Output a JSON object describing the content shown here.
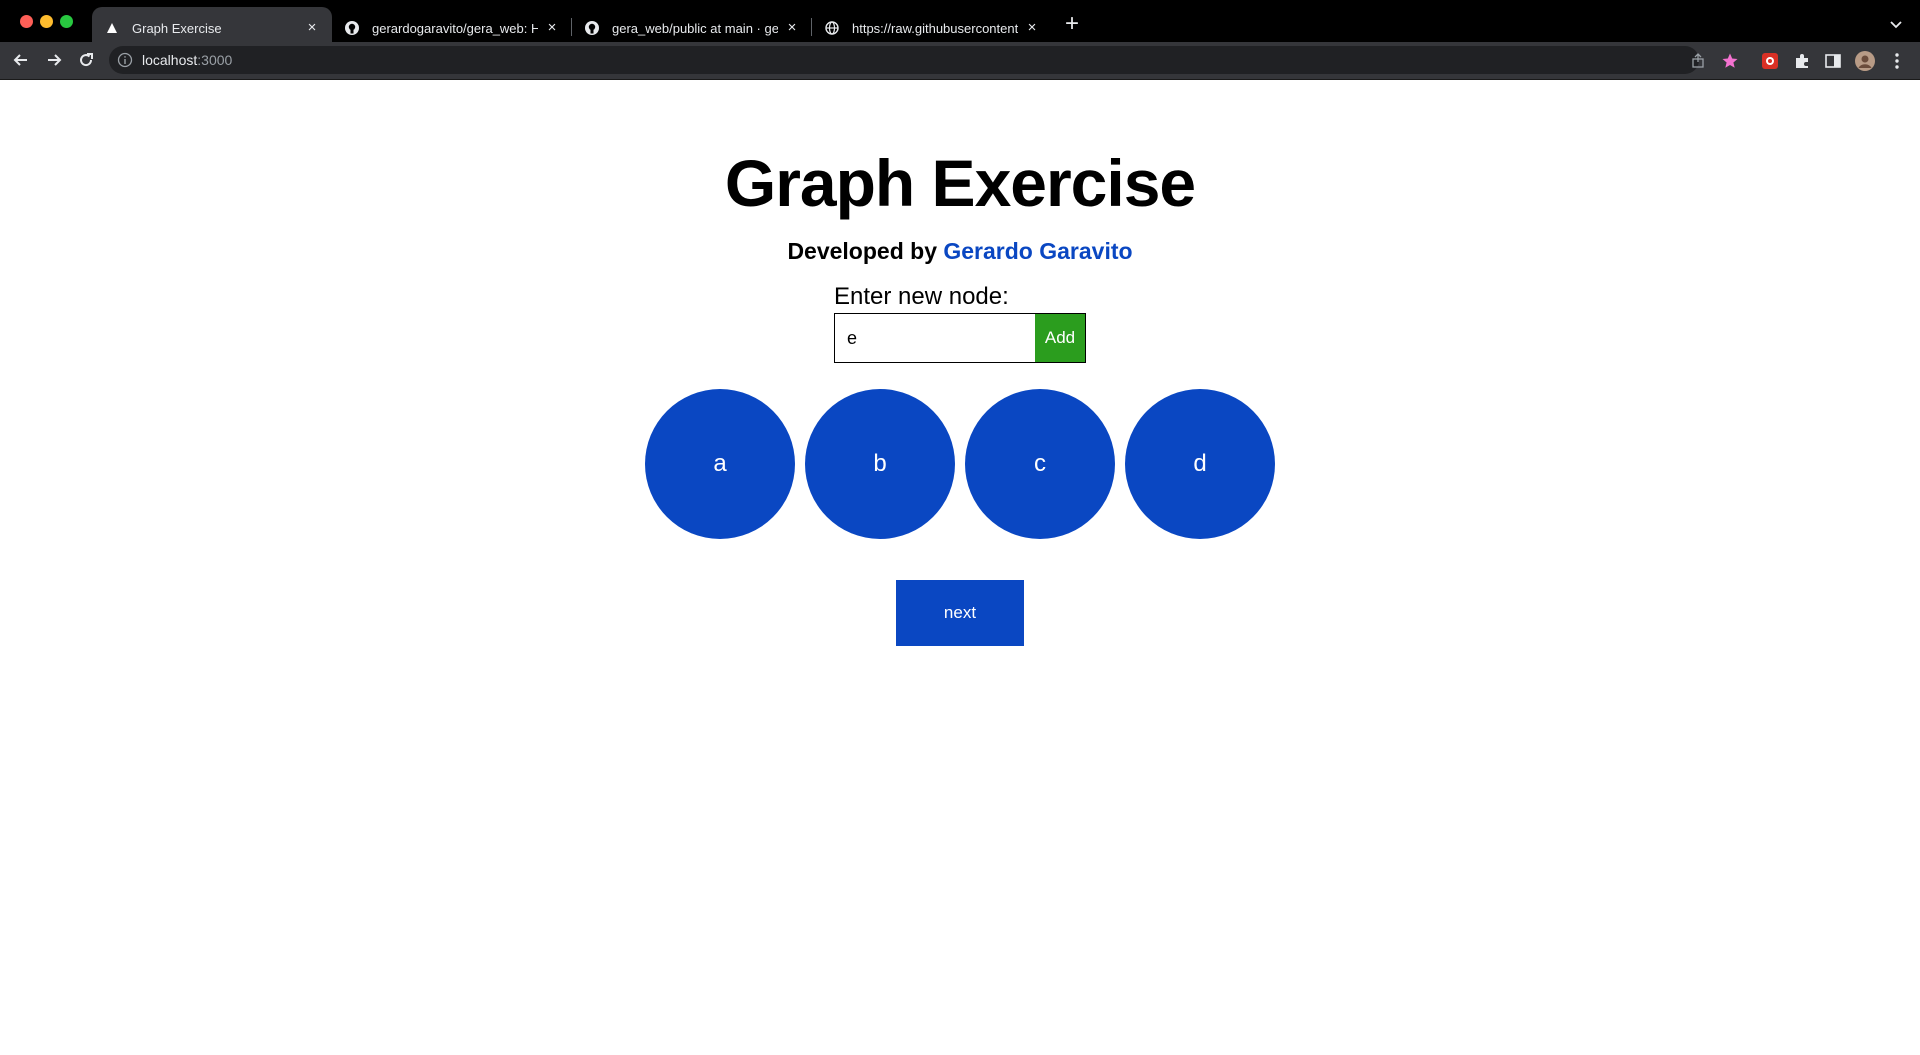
{
  "browser": {
    "tabs": [
      {
        "title": "Graph Exercise",
        "icon": "triangle-favicon-icon",
        "active": true
      },
      {
        "title": "gerardogaravito/gera_web: He",
        "icon": "github-icon",
        "active": false
      },
      {
        "title": "gera_web/public at main · gera",
        "icon": "github-icon",
        "active": false
      },
      {
        "title": "https://raw.githubusercontent.c",
        "icon": "globe-icon",
        "active": false
      }
    ],
    "new_tab": "+",
    "url_host": "localhost",
    "url_port": ":3000",
    "colors": {
      "tabbar": "#000000",
      "toolbar": "#35363a",
      "omnibox": "#202124"
    }
  },
  "page": {
    "title": "Graph Exercise",
    "developer_prefix": "Developed by",
    "developer_name": "Gerardo Garavito",
    "input_label": "Enter new node:",
    "input_value": "e",
    "add_label": "Add",
    "nodes": [
      "a",
      "b",
      "c",
      "d"
    ],
    "next_label": "next",
    "colors": {
      "node": "#0a47c2",
      "add_button": "#2b9d1e",
      "link": "#0a47c2"
    }
  }
}
